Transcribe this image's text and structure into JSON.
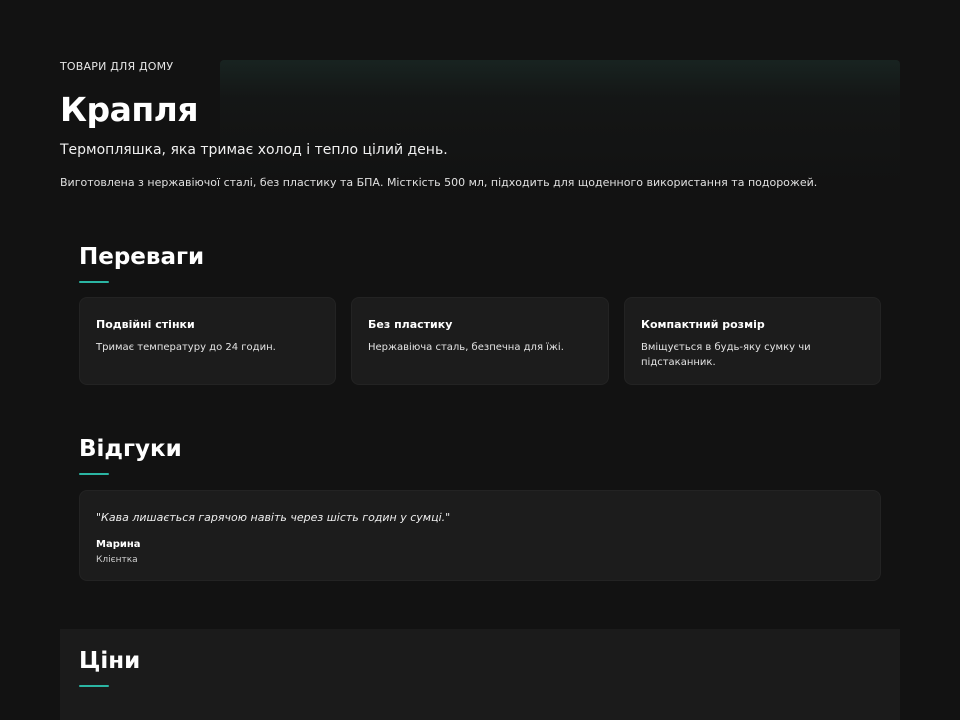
{
  "hero": {
    "eyebrow": "ТОВАРИ ДЛЯ ДОМУ",
    "title": "Крапля",
    "subtitle": "Термопляшка, яка тримає холод і тепло цілий день.",
    "description": "Виготовлена з нержавіючої сталі, без пластику та БПА. Місткість 500 мл, підходить для щоденного використання та подорожей."
  },
  "benefits": {
    "heading": "Переваги",
    "items": [
      {
        "title": "Подвійні стінки",
        "text": "Тримає температуру до 24 годин."
      },
      {
        "title": "Без пластику",
        "text": "Нержавіюча сталь, безпечна для їжі."
      },
      {
        "title": "Компактний розмір",
        "text": "Вміщується в будь-яку сумку чи підстаканник."
      }
    ]
  },
  "reviews": {
    "heading": "Відгуки",
    "items": [
      {
        "quote": "\"Кава лишається гарячою навіть через шість годин у сумці.\"",
        "name": "Марина",
        "role": "Клієнтка"
      }
    ]
  },
  "pricing": {
    "heading": "Ціни"
  },
  "colors": {
    "background": "#121212",
    "card": "#1c1c1c",
    "accent": "#2bb5a3"
  }
}
